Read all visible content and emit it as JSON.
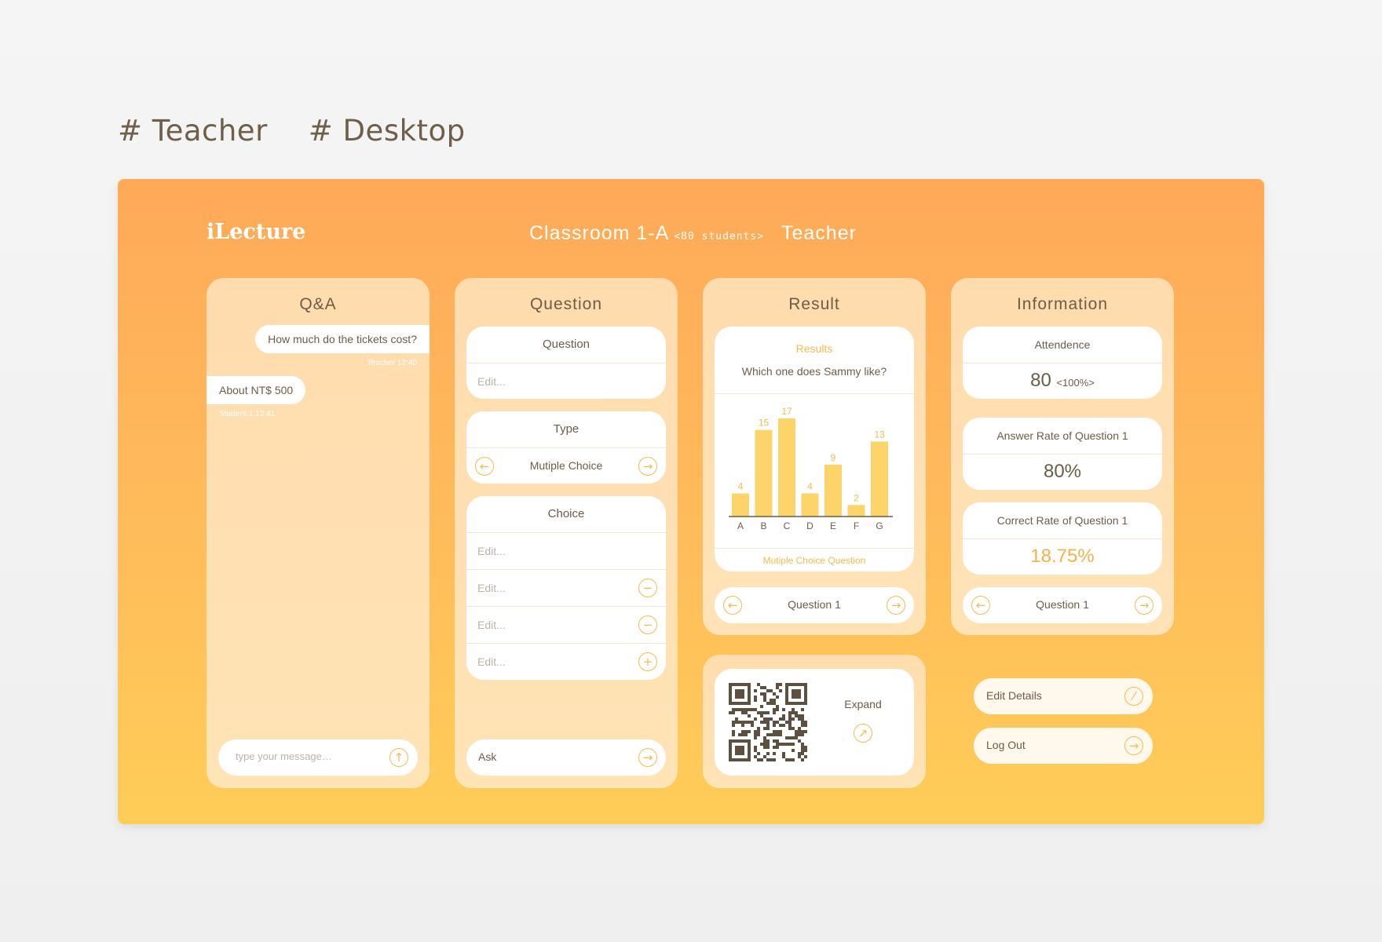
{
  "tags": [
    "# Teacher",
    "# Desktop"
  ],
  "header": {
    "brand": "iLecture",
    "classroom": "Classroom 1-A",
    "students": "<80 students>",
    "role": "Teacher"
  },
  "qa": {
    "title": "Q&A",
    "messages": [
      {
        "text": "How much do the tickets cost?",
        "meta": "Teacher  12:40"
      },
      {
        "text": "About NT$ 500",
        "meta": "Student-1  12:41"
      }
    ],
    "input_placeholder": "type your message…",
    "send_icon": "arrow-up-icon"
  },
  "question": {
    "title": "Question",
    "question_label": "Question",
    "question_placeholder": "Edit...",
    "type_label": "Type",
    "type_value": "Mutiple Choice",
    "choice_label": "Choice",
    "choice_placeholders": [
      "Edit...",
      "Edit...",
      "Edit...",
      "Edit..."
    ],
    "ask_label": "Ask"
  },
  "result": {
    "title": "Result",
    "card_title": "Results",
    "question_text": "Which one does Sammy like?",
    "footer": "Mutiple Choice Question",
    "nav_label": "Question 1",
    "expand_label": "Expand"
  },
  "chart_data": {
    "type": "bar",
    "categories": [
      "A",
      "B",
      "C",
      "D",
      "E",
      "F",
      "G"
    ],
    "values": [
      4,
      15,
      17,
      4,
      9,
      2,
      13
    ],
    "ylim": [
      0,
      17
    ],
    "color": "#fcd46a",
    "label_color": "#f7ba4e"
  },
  "information": {
    "title": "Information",
    "attendance_label": "Attendence",
    "attendance_value": "80",
    "attendance_pct": "<100%>",
    "answer_rate_label": "Answer Rate of Question 1",
    "answer_rate_value": "80%",
    "correct_rate_label": "Correct Rate of Question 1",
    "correct_rate_value": "18.75%",
    "nav_label": "Question 1"
  },
  "actions": {
    "edit_details": "Edit Details",
    "log_out": "Log Out"
  },
  "colors": {
    "accent": "#f7ba4e",
    "text": "#6d5c48",
    "bg_top": "#ffa959",
    "bg_bottom": "#ffcd58"
  }
}
